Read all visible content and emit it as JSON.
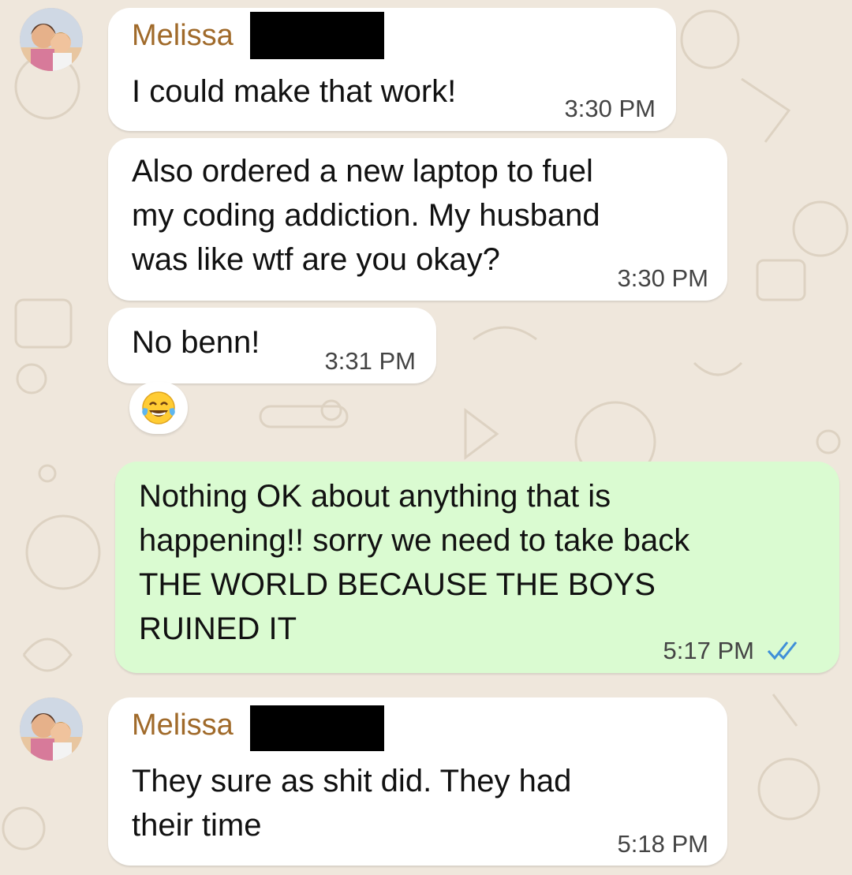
{
  "chat": {
    "messages": [
      {
        "sender": "Melissa",
        "text": "I could make that work!",
        "time": "3:30 PM"
      },
      {
        "text": "Also ordered a new laptop to fuel\nmy coding addiction. My husband\nwas like wtf are you okay?",
        "time": "3:30 PM"
      },
      {
        "text": "No benn!",
        "time": "3:31 PM",
        "reaction": "😂"
      },
      {
        "text": "Nothing OK about anything that is\nhappening!! sorry we need to take back\nTHE WORLD BECAUSE THE BOYS\nRUINED IT",
        "time": "5:17 PM",
        "outgoing": true,
        "status": "read-double-check-icon"
      },
      {
        "sender": "Melissa",
        "text": "They sure as shit did. They had\ntheir time",
        "time": "5:18 PM"
      }
    ]
  },
  "colors": {
    "background": "#efe7dc",
    "incoming_bubble": "#ffffff",
    "outgoing_bubble": "#dafbd1",
    "sender_name": "#a06a2a",
    "read_ticks": "#3f8fd8"
  }
}
